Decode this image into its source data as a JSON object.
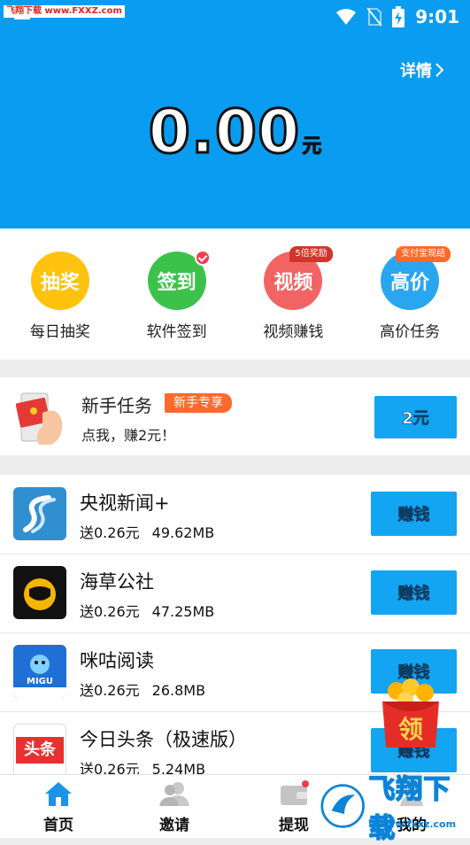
{
  "status_bar": {
    "watermark": "飞翔下载 www.FXXZ.com",
    "time": "9:01"
  },
  "header": {
    "detail_label": "详情",
    "balance": "0.00",
    "unit": "元"
  },
  "features": [
    {
      "icon_text": "抽奖",
      "label": "每日抽奖",
      "color": "#ffc20e"
    },
    {
      "icon_text": "签到",
      "label": "软件签到",
      "color": "#3cc24b",
      "badge": "check"
    },
    {
      "icon_text": "视频",
      "label": "视频赚钱",
      "color": "#f26464",
      "ribbon": "5倍奖励"
    },
    {
      "icon_text": "高价",
      "label": "高价任务",
      "color": "#2aa6f0",
      "ribbon": "支付宝现结"
    }
  ],
  "newbie": {
    "title": "新手任务",
    "tag": "新手专享",
    "subtitle": "点我，赚2元！",
    "button": "2元"
  },
  "apps": [
    {
      "name": "央视新闻+",
      "reward": "送0.26元",
      "size": "49.62MB",
      "button": "赚钱"
    },
    {
      "name": "海草公社",
      "reward": "送0.26元",
      "size": "47.25MB",
      "button": "赚钱"
    },
    {
      "name": "咪咕阅读",
      "reward": "送0.26元",
      "size": "26.8MB",
      "button": "赚钱"
    },
    {
      "name": "今日头条（极速版）",
      "reward": "送0.26元",
      "size": "5.24MB",
      "button": "赚钱"
    }
  ],
  "app_icon_texts": {
    "migu": "MIGU",
    "toutiao": "头条"
  },
  "floating_pack": "领",
  "bottom_nav": [
    {
      "label": "首页",
      "active": true
    },
    {
      "label": "邀请"
    },
    {
      "label": "提现"
    },
    {
      "label": "我的"
    }
  ],
  "watermark_br": {
    "text": "飞翔下载",
    "url": "www.fxxz.com"
  }
}
